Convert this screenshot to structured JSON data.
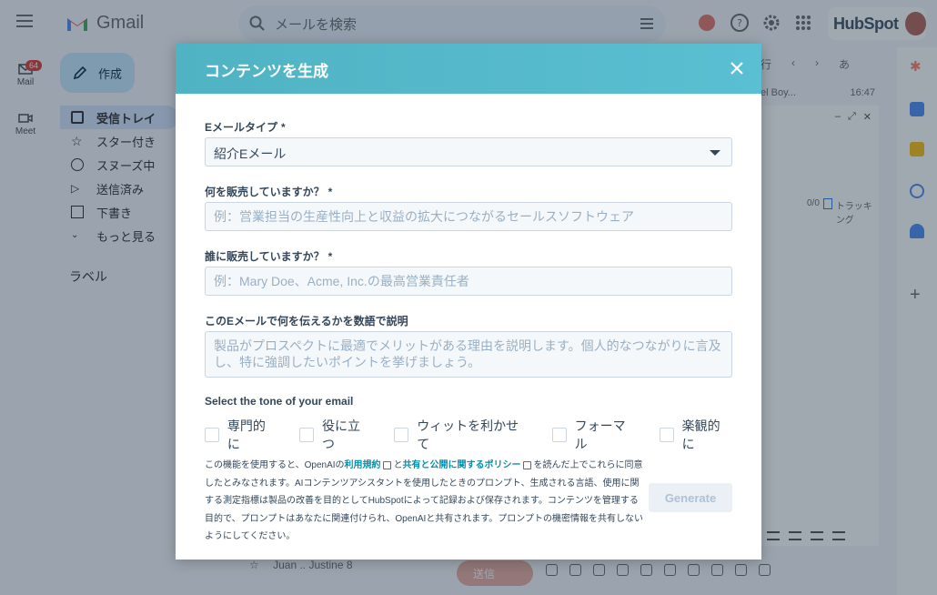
{
  "gmail": {
    "app_name": "Gmail",
    "search_placeholder": "メールを検索",
    "hubspot_label": "HubSpot",
    "rail": {
      "mail_label": "Mail",
      "mail_badge": "64",
      "meet_label": "Meet"
    },
    "compose_label": "作成",
    "nav": [
      {
        "label": "受信トレイ"
      },
      {
        "label": "スター付き"
      },
      {
        "label": "スヌーズ中"
      },
      {
        "label": "送信済み"
      },
      {
        "label": "下書き"
      },
      {
        "label": "もっと見る"
      }
    ],
    "labels_heading": "ラベル",
    "toolbar": {
      "row_text": "行",
      "lang": "あ"
    },
    "mail_row": {
      "sender": "el Boy...",
      "time": "16:47"
    },
    "tracking_label": "トラッキング",
    "tracking_count": "0/0",
    "bottom_row": {
      "sender": "Juan .. Justine",
      "count": "8"
    },
    "send_label": "送信"
  },
  "modal": {
    "title": "コンテンツを生成",
    "fields": {
      "email_type": {
        "label": "Eメールタイプ",
        "required": "*",
        "value": "紹介Eメール"
      },
      "product": {
        "label": "何を販売していますか？",
        "required": "*",
        "placeholder": "例：営業担当の生産性向上と収益の拡大につながるセールスソフトウェア"
      },
      "audience": {
        "label": "誰に販売していますか？",
        "required": "*",
        "placeholder": "例：Mary Doe、Acme, Inc.の最高営業責任者"
      },
      "message": {
        "label": "このEメールで何を伝えるかを数語で説明",
        "placeholder": "製品がプロスペクトに最適でメリットがある理由を説明します。個人的なつながりに言及し、特に強調したいポイントを挙げましょう。"
      }
    },
    "tone": {
      "label": "Select the tone of your email",
      "options": [
        "専門的に",
        "役に立つ",
        "ウィットを利かせて",
        "フォーマル",
        "楽観的に"
      ]
    },
    "disclaimer": {
      "prefix": "この機能を使用すると、OpenAIの",
      "terms_link": "利用規約",
      "middle": "と",
      "policy_link": "共有と公開に関するポリシー",
      "suffix": "を読んだ上でこれらに同意したとみなされます。AIコンテンツアシスタントを使用したときのプロンプト、生成される言語、使用に関する測定指標は製品の改善を目的としてHubSpotによって記録および保存されます。コンテンツを管理する目的で、プロンプトはあなたに関連付けられ、OpenAIと共有されます。プロンプトの機密情報を共有しないようにしてください。"
    },
    "generate_label": "Generate"
  },
  "colors": {
    "header_gradient_start": "#4fb3c3",
    "header_gradient_end": "#5bbfd3",
    "link": "#0091ae",
    "text": "#33475b",
    "gmail_red": "#d93025"
  }
}
